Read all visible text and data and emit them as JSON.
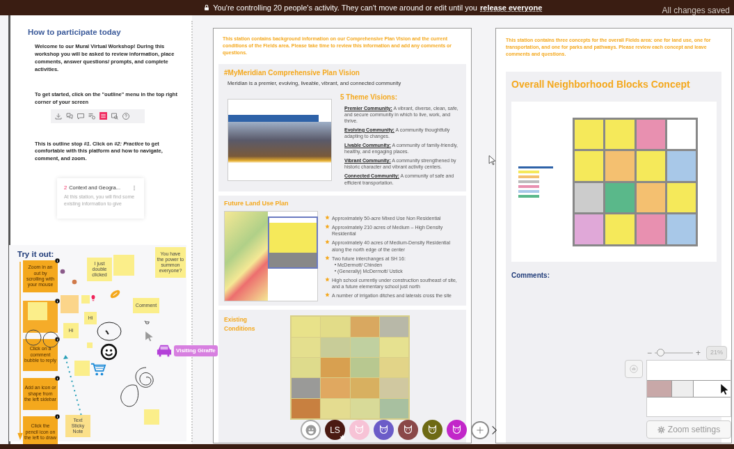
{
  "banner": {
    "message": "You're controlling 20 people's activity. They can't move around or edit until you",
    "link": "release everyone",
    "save_status": "All changes saved"
  },
  "intro": {
    "title": "How to participate today",
    "welcome": "Welcome to our Mural Virtual Workshop! During this workshop you will be asked to review information, place comments, answer questions/ prompts, and complete activities.",
    "get_started": "To get started, click on the \"outline\" menu in the top right corner of your screen",
    "outline_stop": "This is outline stop *#1*. Click on *#2: Practice* to get comfortable with this platform and how to navigate, comment, and zoom.",
    "outline_card": {
      "number": "2",
      "title": "Context and Geogra...",
      "preview": "At this station, you will find some existing information to give"
    }
  },
  "practice": {
    "title": "Try it out:",
    "steps": [
      {
        "kind": "text",
        "text": "Zoom in an out by scrolling with your mouse"
      },
      {
        "kind": "covered"
      },
      {
        "kind": "text",
        "text": "Click on a comment bubble to reply"
      },
      {
        "kind": "text",
        "text": "Add an icon or shape from the left sidebar"
      },
      {
        "kind": "text",
        "text": "Click the pencil icon on the left to draw"
      }
    ],
    "notes": [
      {
        "text": "I just double clicked",
        "color": "#fbee8a"
      },
      {
        "color": "#fbee8a"
      },
      {
        "text": "You have the power to summon everyone?",
        "color": "#fbee8a"
      },
      {
        "text": "Comment",
        "color": "#fbee8a"
      },
      {
        "text": "Hi",
        "color": "#fbee8a"
      },
      {
        "text": "Hi",
        "color": "#fbee8a"
      },
      {
        "color": "#fbd58a"
      },
      {
        "color": "#fbee8a"
      },
      {
        "color": "#fbee8a"
      },
      {
        "color": "#fbee8a"
      },
      {
        "color": "#fbee8a"
      },
      {
        "color": "#fbee8a"
      },
      {
        "text": "Text Sticky Note",
        "color": "#fbe08a"
      }
    ],
    "cursor_label": "Visiting Giraffe"
  },
  "station_1": {
    "intro": "This station contains background information on our Comprehensive Plan Vision and the current conditions of the Fields area. Please take time to review this information and add any comments or questions.",
    "vision": {
      "title": "#MyMeridian Comprehensive Plan Vision",
      "statement": "Meridian is a premier, evolving, liveable, vibrant, and connected community",
      "themes_title": "5 Theme Visions:",
      "themes": [
        {
          "name": "Premier Community:",
          "text": "A vibrant, diverse, clean, safe, and secure community in which to live, work, and thrive."
        },
        {
          "name": "Evolving Community:",
          "text": "A community thoughtfully adapting to changes."
        },
        {
          "name": "Livable Community:",
          "text": "A community of family-friendly, healthy, and engaging places."
        },
        {
          "name": "Vibrant Community:",
          "text": "A community strengthened by historic character and vibrant activity centers."
        },
        {
          "name": "Connected Community:",
          "text": "A community of safe and efficient transportation."
        }
      ]
    },
    "land_use": {
      "title": "Future Land Use Plan",
      "bullets": [
        {
          "text": "Approximately 50-acre Mixed Use Non Residential"
        },
        {
          "text": "Approximately 210 acres of Medium – High Density Residential"
        },
        {
          "text": "Approximately 40 acres of Medium-Density Residential along the north edge of the center"
        },
        {
          "text": "Two future interchanges at SH 16:",
          "children": [
            "McDermott/ Chinden",
            "(Generally) McDermott/ Ustick"
          ]
        },
        {
          "text": "High school currently under construction southeast of site, and a future elementary school just north"
        },
        {
          "text": "A number of irrigation ditches and laterals cross the site"
        }
      ]
    },
    "existing": {
      "title": "Existing Conditions"
    }
  },
  "station_2": {
    "intro": "This station contains three concepts for the overall Fields area: one for land use, one for transportation, and one for parks and pathways. Please review each concept and leave comments and questions.",
    "title": "Overall Neighborhood Blocks Concept",
    "comments_label": "Comments:"
  },
  "collaborators": [
    {
      "kind": "smiley",
      "color": "#ffffff"
    },
    {
      "kind": "initials",
      "initials": "LS",
      "color": "#4a1a12"
    },
    {
      "kind": "animal",
      "color": "#f7c3d6"
    },
    {
      "kind": "animal",
      "color": "#6b5cc8"
    },
    {
      "kind": "animal",
      "color": "#8a4848"
    },
    {
      "kind": "animal",
      "color": "#6e6a14"
    },
    {
      "kind": "animal",
      "color": "#c227c9"
    }
  ],
  "zoom": {
    "zoom_out": "−",
    "zoom_in": "+",
    "level": 0.15,
    "reading": "21%",
    "settings": "Zoom settings"
  }
}
